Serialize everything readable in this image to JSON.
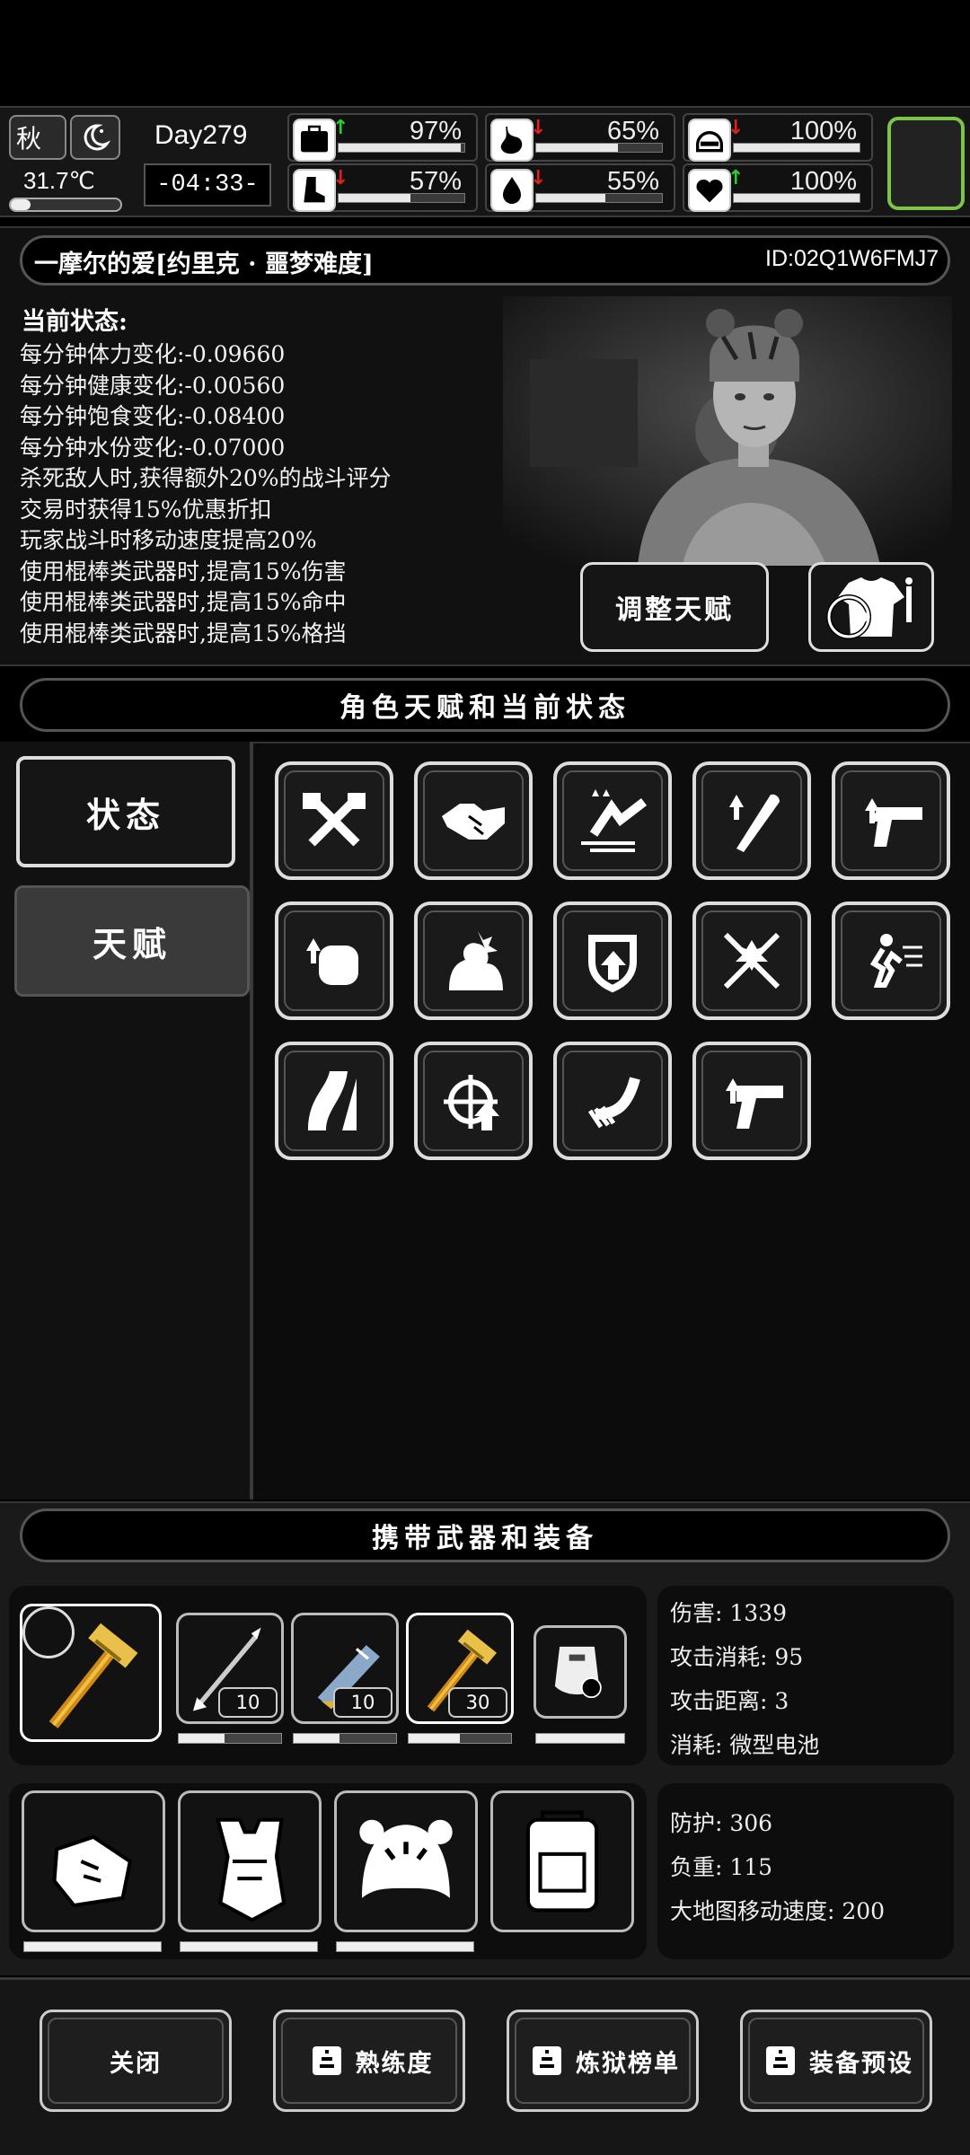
{
  "hud": {
    "season": "秋",
    "temperature": "31.7℃",
    "day": "Day279",
    "clock": "-04:33-",
    "stats": [
      {
        "icon": "medkit-icon",
        "trend": "up",
        "value": "97%",
        "level": 0.97
      },
      {
        "icon": "stomach-icon",
        "trend": "down",
        "value": "65%",
        "level": 0.65
      },
      {
        "icon": "helmet-icon",
        "trend": "down",
        "value": "100%",
        "level": 1.0
      },
      {
        "icon": "boot-icon",
        "trend": "down",
        "value": "57%",
        "level": 0.57
      },
      {
        "icon": "water-drop-icon",
        "trend": "down",
        "value": "55%",
        "level": 0.55
      },
      {
        "icon": "heart-icon",
        "trend": "up",
        "value": "100%",
        "level": 1.0
      }
    ]
  },
  "character": {
    "name": "一摩尔的爱[约里克 · 噩梦难度]",
    "id": "ID:02Q1W6FMJ7",
    "status_title": "当前状态:",
    "status_lines": [
      "每分钟体力变化:-0.09660",
      "每分钟健康变化:-0.00560",
      "每分钟饱食变化:-0.08400",
      "每分钟水份变化:-0.07000",
      "杀死敌人时,获得额外20%的战斗评分",
      "交易时获得15%优惠折扣",
      "玩家战斗时移动速度提高20%",
      "使用棍棒类武器时,提高15%伤害",
      "使用棍棒类武器时,提高15%命中",
      "使用棍棒类武器时,提高15%格挡"
    ],
    "adjust_talent_label": "调整天赋"
  },
  "talents_section": {
    "title": "角色天赋和当前状态",
    "tabs": [
      "状态",
      "天赋"
    ],
    "icons": [
      "crossed-axes-icon",
      "handshake-icon",
      "dash-speed-icon",
      "club-upgrade-icon",
      "pistol-upgrade-icon",
      "fist-upgrade-icon",
      "flex-arm-icon",
      "shield-upgrade-icon",
      "crossed-swords-icon",
      "running-man-icon",
      "road-icon",
      "crosshair-upgrade-icon",
      "hand-grab-icon",
      "gun-upgrade-icon"
    ]
  },
  "equipment": {
    "title": "携带武器和装备",
    "weapons": [
      {
        "icon": "hammer-icon",
        "count": "",
        "durability": 1.0
      },
      {
        "icon": "spear-icon",
        "count": "10",
        "durability": 0.45
      },
      {
        "icon": "blaster-icon",
        "count": "10",
        "durability": 0.45
      },
      {
        "icon": "hammer-icon",
        "count": "30",
        "durability": 0.5
      },
      {
        "icon": "riot-shield-icon",
        "count": "",
        "durability": 1.0
      }
    ],
    "weapon_stats": [
      "伤害: 1339",
      "攻击消耗: 95",
      "攻击距离: 3",
      "消耗: 微型电池"
    ],
    "armor": [
      {
        "icon": "gloves-icon",
        "durability": 1.0
      },
      {
        "icon": "body-armor-icon",
        "durability": 1.0
      },
      {
        "icon": "tiger-hat-icon",
        "durability": 1.0
      },
      {
        "icon": "backpack-icon",
        "durability": 1.0
      }
    ],
    "armor_stats": [
      "防护: 306",
      "负重: 115",
      "大地图移动速度: 200"
    ]
  },
  "footer": {
    "buttons": [
      "关闭",
      "熟练度",
      "炼狱榜单",
      "装备预设"
    ]
  },
  "colors": {
    "up": "#2bd12b",
    "down": "#e02020",
    "highlight": "#7ec34a"
  }
}
